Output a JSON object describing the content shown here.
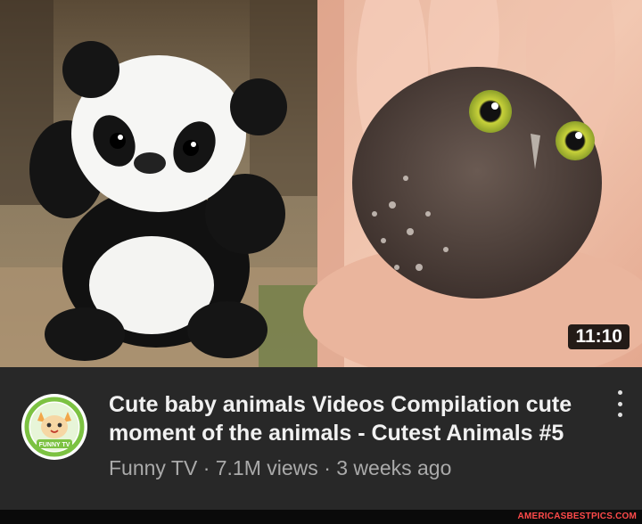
{
  "video": {
    "duration": "11:10",
    "title": "Cute baby animals Videos Compilation cute moment of the animals - Cutest Animals #5",
    "channel": "Funny TV",
    "views": "7.1M views",
    "age": "3 weeks ago"
  },
  "channel_avatar": {
    "label": "FUNNY TV",
    "icon": "cartoon-cat-avatar",
    "ring_color": "#7cc242"
  },
  "menu": {
    "icon": "more-vert-icon"
  },
  "watermark": "AMERICASBESTPICS.COM",
  "colors": {
    "title": "#f1f1f1",
    "meta": "#aaaaaa",
    "panel": "#282828",
    "watermark": "#ff4a4a"
  }
}
